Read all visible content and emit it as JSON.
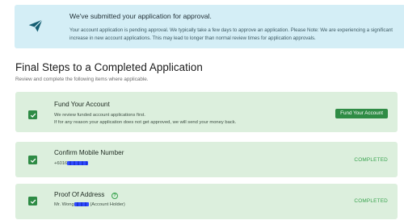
{
  "banner": {
    "title": "We've submitted your application for approval.",
    "body": "Your account application is pending approval. We typically take a few days to approve an application. Please Note: We are experiencing a significant increase in new account applications. This may lead to longer than normal review times for application approvals.",
    "icon": "paper-plane-icon"
  },
  "steps": {
    "heading": "Final Steps to a Completed Application",
    "subheading": "Review and complete the following items where applicable."
  },
  "cards": [
    {
      "title": "Fund Your Account",
      "desc_line1": "We review funded account applications first.",
      "desc_line2": "If for any reason your application does not get approved, we will send your money back.",
      "button": "Fund Your Account"
    },
    {
      "title": "Confirm Mobile Number",
      "value_prefix": "+6016",
      "status": "COMPLETED"
    },
    {
      "title": "Proof Of Address",
      "value_prefix": "Mr. Wong",
      "value_suffix": "(Account Holder)",
      "help_glyph": "?",
      "status": "COMPLETED"
    }
  ],
  "colors": {
    "banner_bg": "#d4eef6",
    "card_bg": "#dcefdd",
    "accent_green": "#2f8c45",
    "status_green": "#3aa34f",
    "redaction_blue": "#2f4bff"
  }
}
